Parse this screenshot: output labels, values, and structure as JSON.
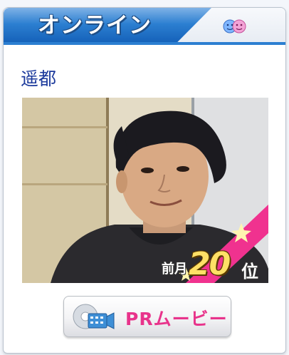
{
  "tabs": {
    "online_label": "オンライン",
    "second_tab_icon": "two-faces-icon"
  },
  "profile": {
    "name": "遥都"
  },
  "rank": {
    "prefix": "前月",
    "number": "20",
    "suffix": "位"
  },
  "pr_button": {
    "label": "PRムービー",
    "icon": "video-camera-icon"
  },
  "colors": {
    "tab_blue": "#1460b8",
    "name_blue": "#1c3a9c",
    "pr_pink": "#e8338b",
    "badge_pink": "#f0328f"
  }
}
